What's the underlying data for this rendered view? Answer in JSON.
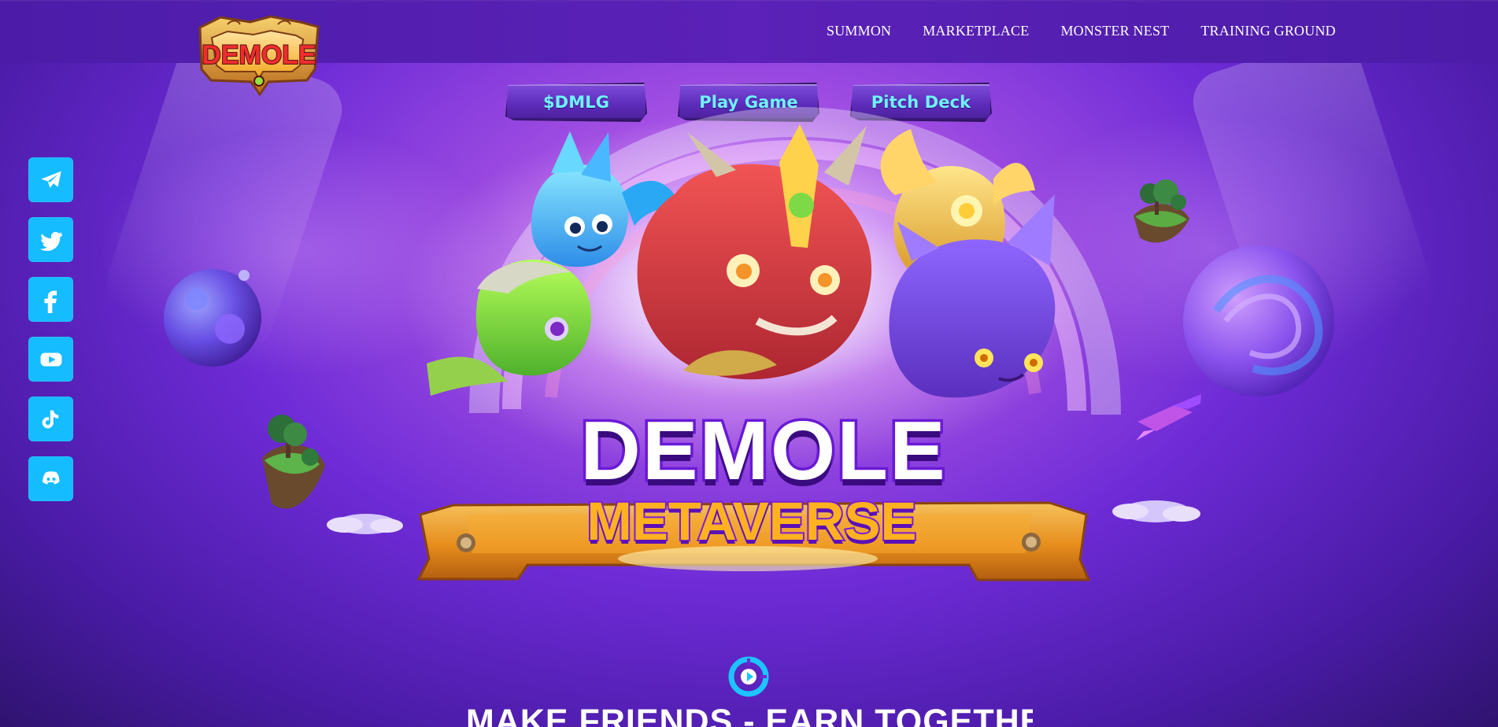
{
  "nav": {
    "items": [
      "SUMMON",
      "MARKETPLACE",
      "MONSTER NEST",
      "TRAINING GROUND"
    ]
  },
  "cta": {
    "buttons": [
      "$DMLG",
      "Play Game",
      "Pitch Deck"
    ]
  },
  "logo": {
    "text": "DEMOLE"
  },
  "hero": {
    "title": "DEMOLE",
    "subtitle": "METAVERSE"
  },
  "section": {
    "heading": "MAKE FRIENDS - EARN TOGETHER"
  },
  "socials": [
    "telegram-icon",
    "twitter-icon",
    "facebook-icon",
    "youtube-icon",
    "tiktok-icon",
    "discord-icon"
  ],
  "colors": {
    "accent_cyan": "#15bcff",
    "header_purple": "#4c1ca8",
    "button_text": "#6ff4ff",
    "title_gold": "#ffb11f"
  }
}
